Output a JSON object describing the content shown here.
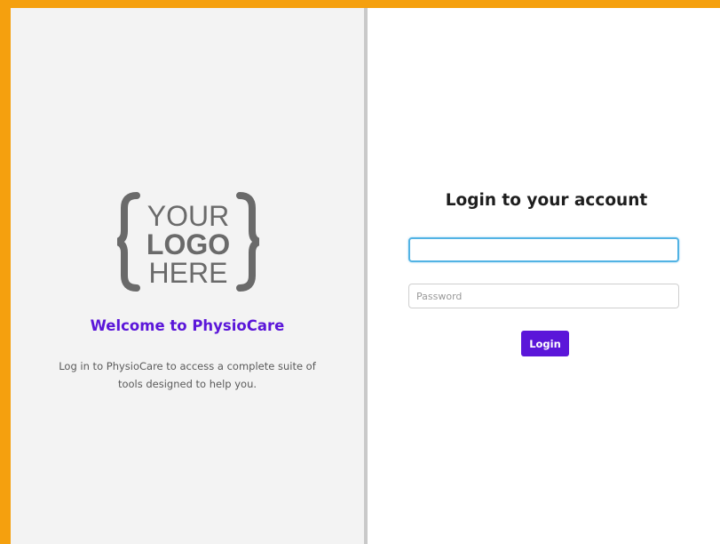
{
  "logo": {
    "line1": "YOUR",
    "line2": "LOGO",
    "line3": "HERE"
  },
  "left_panel": {
    "welcome": "Welcome to PhysioCare",
    "description": "Log in to PhysioCare to access a complete suite of tools designed to help you."
  },
  "login": {
    "title": "Login to your account",
    "username_value": "",
    "password_placeholder": "Password",
    "button_label": "Login"
  },
  "colors": {
    "accent": "#5b16d9",
    "background_frame": "#f5a00e",
    "focus_border": "#52b3e4"
  }
}
